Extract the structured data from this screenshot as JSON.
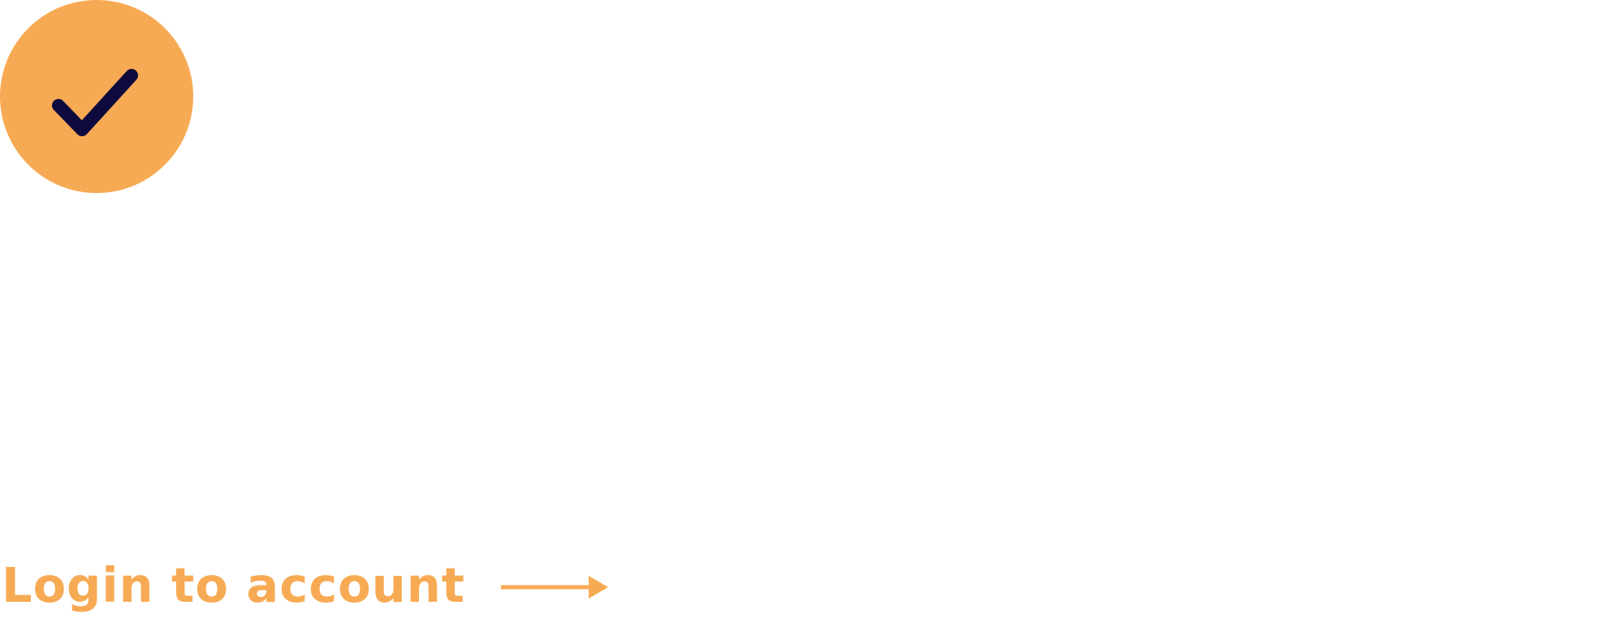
{
  "success_badge": {
    "icon": "checkmark-icon",
    "circle_color": "#F7AA54",
    "check_color": "#0E0A3D"
  },
  "login": {
    "label": "Login to account",
    "icon": "arrow-right-icon",
    "color": "#F7AA54"
  }
}
